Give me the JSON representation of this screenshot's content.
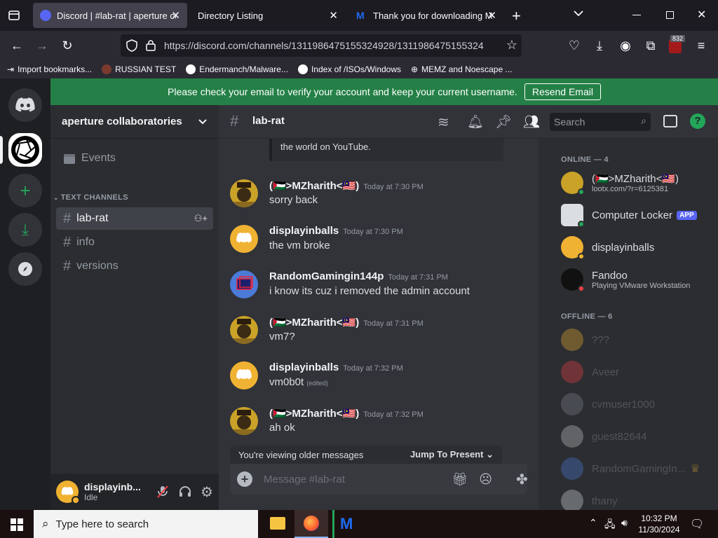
{
  "browser": {
    "tabs": [
      {
        "title": "Discord | #lab-rat | aperture coll",
        "active": true
      },
      {
        "title": "Directory Listing",
        "active": false
      },
      {
        "title": "Thank you for downloading Ma",
        "active": false
      }
    ],
    "url": "https://discord.com/channels/1311986475155324928/1311986475155324",
    "ext_badge": "832",
    "bookmarks": [
      "Import bookmarks...",
      "RUSSIAN TEST",
      "Endermanch/Malware...",
      "Index of /ISOs/Windows",
      "MEMZ and Noescape ..."
    ]
  },
  "banner": {
    "text": "Please check your email to verify your account and keep your current username.",
    "button": "Resend Email"
  },
  "server": {
    "name": "aperture collaboratories",
    "events_label": "Events",
    "category": "TEXT CHANNELS",
    "channels": [
      "lab-rat",
      "info",
      "versions"
    ]
  },
  "channel_header": {
    "name": "lab-rat",
    "search_placeholder": "Search"
  },
  "messages": {
    "quote_fragment": "the world on YouTube.",
    "items": [
      {
        "author": "(🇵🇸>MZharith<🇲🇾)",
        "time": "Today at 7:30 PM",
        "text": "sorry back",
        "edited": ""
      },
      {
        "author": "displayinballs",
        "time": "Today at 7:30 PM",
        "text": "the vm broke",
        "edited": ""
      },
      {
        "author": "RandomGamingin144p",
        "time": "Today at 7:31 PM",
        "text": "i know its cuz i removed the admin account",
        "edited": ""
      },
      {
        "author": "(🇵🇸>MZharith<🇲🇾)",
        "time": "Today at 7:31 PM",
        "text": "vm7?",
        "edited": ""
      },
      {
        "author": "displayinballs",
        "time": "Today at 7:32 PM",
        "text": "vm0b0t",
        "edited": "(edited)"
      },
      {
        "author": "(🇵🇸>MZharith<🇲🇾)",
        "time": "Today at 7:32 PM",
        "text": "ah ok",
        "edited": ""
      }
    ],
    "older_notice": "You're viewing older messages",
    "jump_label": "Jump To Present",
    "composer_placeholder": "Message #lab-rat"
  },
  "members": {
    "online_header": "ONLINE — 4",
    "offline_header": "OFFLINE — 6",
    "online": [
      {
        "name": "(🇵🇸>MZharith<🇲🇾)",
        "sub": "lootx.com/?r=6125381"
      },
      {
        "name": "Computer Locker",
        "badge": "APP",
        "sub": ""
      },
      {
        "name": "displayinballs",
        "sub": ""
      },
      {
        "name": "Fandoo",
        "sub": "Playing VMware Workstation"
      }
    ],
    "offline": [
      "???",
      "Aveer",
      "cvmuser1000",
      "guest82644",
      "RandomGamingIn...",
      "thany"
    ]
  },
  "user_panel": {
    "name": "displayinb...",
    "status": "Idle"
  },
  "taskbar": {
    "search_placeholder": "Type here to search",
    "time": "10:32 PM",
    "date": "11/30/2024"
  },
  "colors": {
    "blurple": "#5865f2",
    "green": "#248046",
    "idle": "#f0b232",
    "dnd": "#f23f43",
    "online": "#23a55a"
  }
}
